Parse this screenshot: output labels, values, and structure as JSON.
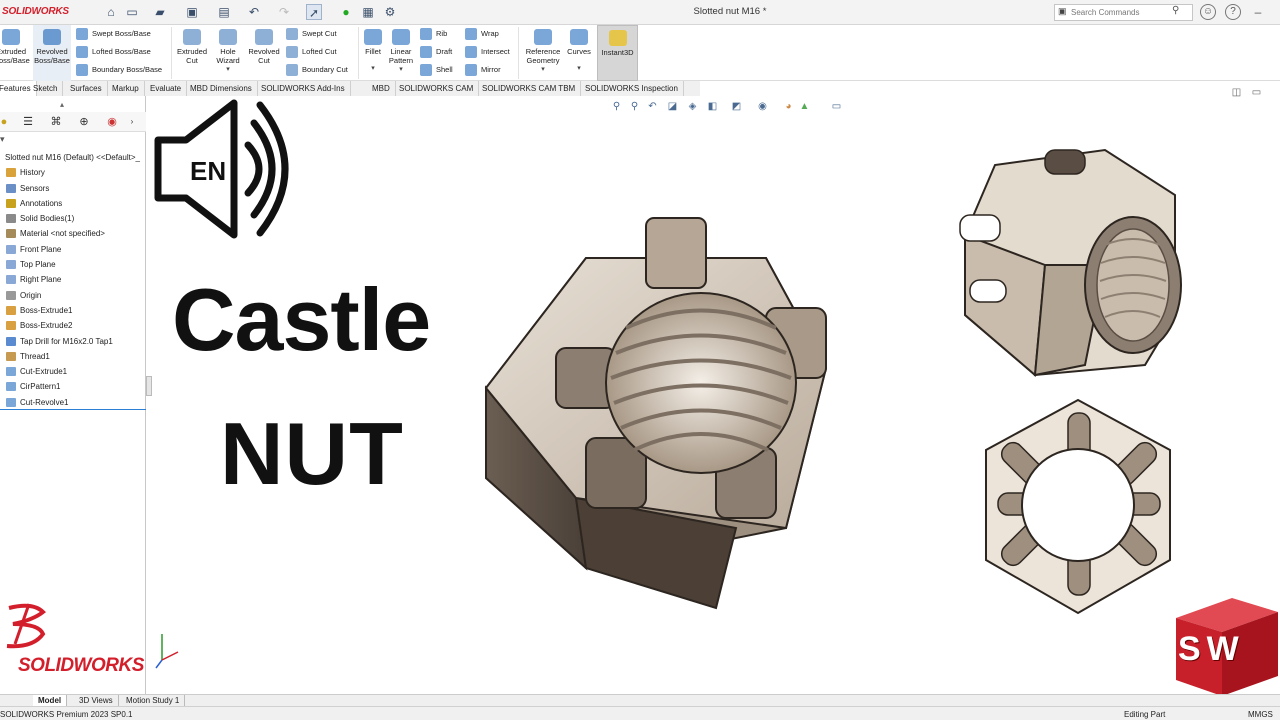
{
  "app": {
    "logo_text": "SOLIDWORKS",
    "document_title": "Slotted nut M16 *",
    "search_placeholder": "Search Commands"
  },
  "command_manager": {
    "big_buttons": [
      {
        "label": "Extruded\nBoss/Base",
        "icon": "extruded-boss-icon"
      },
      {
        "label": "Revolved\nBoss/Base",
        "icon": "revolved-boss-icon"
      },
      {
        "label": "Extruded\nCut",
        "icon": "extruded-cut-icon"
      },
      {
        "label": "Hole\nWizard",
        "icon": "hole-wizard-icon"
      },
      {
        "label": "Revolved\nCut",
        "icon": "revolved-cut-icon"
      },
      {
        "label": "Fillet",
        "icon": "fillet-icon"
      },
      {
        "label": "Linear\nPattern",
        "icon": "linear-pattern-icon"
      },
      {
        "label": "Reference\nGeometry",
        "icon": "reference-geometry-icon"
      },
      {
        "label": "Curves",
        "icon": "curves-icon"
      },
      {
        "label": "Instant3D",
        "icon": "instant3d-icon"
      }
    ],
    "small_buttons": [
      {
        "label": "Swept Boss/Base"
      },
      {
        "label": "Lofted Boss/Base"
      },
      {
        "label": "Boundary Boss/Base"
      },
      {
        "label": "Swept Cut"
      },
      {
        "label": "Lofted Cut"
      },
      {
        "label": "Boundary Cut"
      },
      {
        "label": "Rib"
      },
      {
        "label": "Draft"
      },
      {
        "label": "Shell"
      },
      {
        "label": "Wrap"
      },
      {
        "label": "Intersect"
      },
      {
        "label": "Mirror"
      }
    ]
  },
  "tabs": [
    "Features",
    "Sketch",
    "Surfaces",
    "Markup",
    "Evaluate",
    "MBD Dimensions",
    "SOLIDWORKS Add-Ins",
    "MBD",
    "SOLIDWORKS CAM",
    "SOLIDWORKS CAM TBM",
    "SOLIDWORKS Inspection"
  ],
  "feature_tree": {
    "root": "Slotted nut M16 (Default) <<Default>_",
    "items": [
      "History",
      "Sensors",
      "Annotations",
      "Solid Bodies(1)",
      "Material <not specified>",
      "Front Plane",
      "Top Plane",
      "Right Plane",
      "Origin",
      "Boss-Extrude1",
      "Boss-Extrude2",
      "Tap Drill for M16x2.0 Tap1",
      "Thread1",
      "Cut-Extrude1",
      "CirPattern1",
      "Cut-Revolve1"
    ]
  },
  "overlay": {
    "speaker_label": "EN",
    "title_line1": "Castle",
    "title_line2": "NUT",
    "ds_logo_text": "SOLIDWORKS",
    "sw_logo_text": "SW"
  },
  "bottom_tabs": [
    "Model",
    "3D Views",
    "Motion Study 1"
  ],
  "status": {
    "left": "SOLIDWORKS Premium 2023 SP0.1",
    "mode": "Editing Part",
    "units": "MMGS"
  },
  "colors": {
    "accent_red": "#d31f2b",
    "nut_face": "#d9cfc2",
    "nut_dark": "#5a4e44",
    "icon_blue": "#3f7fc4"
  }
}
